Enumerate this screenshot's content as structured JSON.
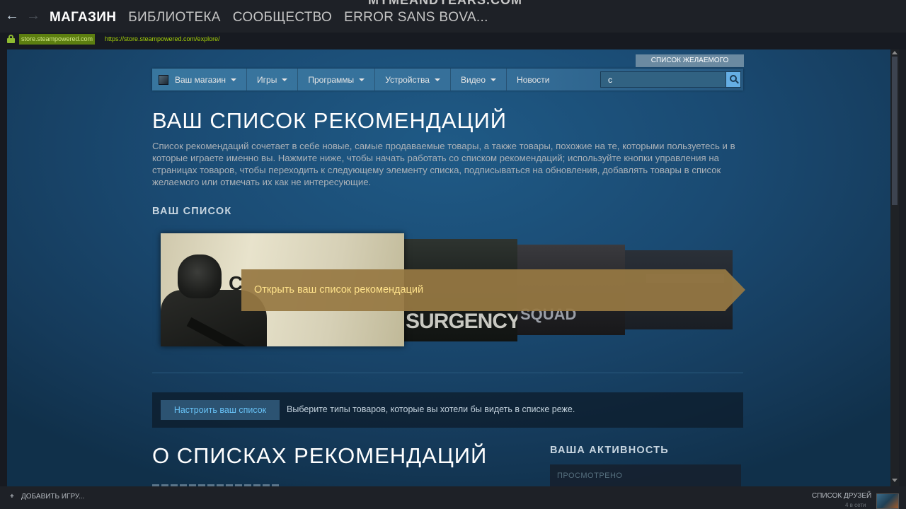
{
  "client": {
    "ghost_title": "MYMEANDYEARS.COM",
    "back_icon": "←",
    "forward_icon": "→",
    "tabs": [
      {
        "label": "МАГАЗИН",
        "active": true
      },
      {
        "label": "БИБЛИОТЕКА",
        "active": false
      },
      {
        "label": "СООБЩЕСТВО",
        "active": false
      },
      {
        "label": "ERROR SANS BOVA...",
        "active": false
      }
    ],
    "domain_chip": "store.steampowered.com",
    "url": "https://store.steampowered.com/explore/"
  },
  "store": {
    "wishlist_label": "СПИСОК ЖЕЛАЕМОГО",
    "nav": [
      {
        "label": "Ваш магазин",
        "dropdown": true
      },
      {
        "label": "Игры",
        "dropdown": true
      },
      {
        "label": "Программы",
        "dropdown": true
      },
      {
        "label": "Устройства",
        "dropdown": true
      },
      {
        "label": "Видео",
        "dropdown": true
      },
      {
        "label": "Новости",
        "dropdown": false
      }
    ],
    "search_value": "c",
    "search_icon": "search-icon"
  },
  "queue_page": {
    "title": "ВАШ СПИСОК РЕКОМЕНДАЦИЙ",
    "description": "Список рекомендаций сочетает в себе новые, самые продаваемые товары, а также товары, похожие на те, которыми пользуетесь и в которые играете именно вы. Нажмите ниже, чтобы начать работать со списком рекомендаций; используйте кнопки управления на страницах товаров, чтобы переходить к следующему элементу списка, подписываться на обновления, добавлять товары в список желаемого или отмечать их как не интересующие.",
    "your_queue_heading": "ВАШ СПИСОК",
    "capsules": [
      {
        "logo_fragment": "C"
      },
      {
        "logo_fragment": "SURGENCY"
      },
      {
        "logo_fragment": "SQUAD"
      },
      {
        "logo_fragment": ""
      }
    ],
    "open_queue_label": "Открыть ваш список рекомендаций",
    "customize_label": "Настроить ваш список",
    "customize_text": "Выберите типы товаров, которые вы хотели бы видеть в списке реже.",
    "about_title": "О СПИСКАХ РЕКОМЕНДАЦИЙ",
    "activity_heading": "ВАША АКТИВНОСТЬ",
    "activity_viewed": "ПРОСМОТРЕНО"
  },
  "bottom": {
    "add_game": "ДОБАВИТЬ ИГРУ...",
    "friends": "СПИСОК ДРУЗЕЙ",
    "online": "4 в сети"
  },
  "colors": {
    "accent_blue": "#67c1f5",
    "gold_button": "#977843",
    "page_bg": "#1a4a72"
  }
}
